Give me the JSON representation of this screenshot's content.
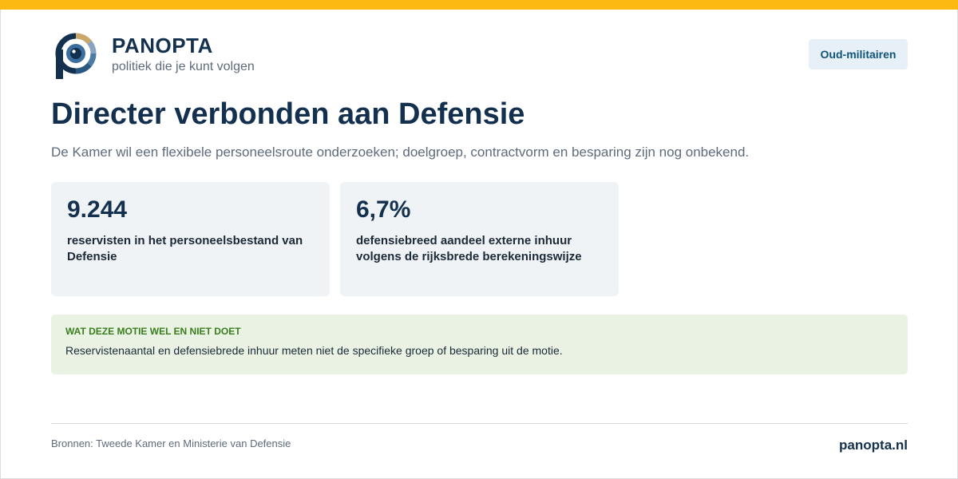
{
  "brand": {
    "name": "PANOPTA",
    "tagline": "politiek die je kunt volgen"
  },
  "topic_tag": "Oud-militairen",
  "headline": "Directer verbonden aan Defensie",
  "summary": "De Kamer wil een flexibele personeelsroute onderzoeken; doelgroep, contractvorm en besparing zijn nog onbekend.",
  "stats": [
    {
      "value": "9.244",
      "label": "reservisten in het personeelsbestand van Defensie"
    },
    {
      "value": "6,7%",
      "label": "defensiebreed aandeel externe inhuur volgens de rijksbrede berekeningswijze"
    }
  ],
  "note": {
    "title": "WAT DEZE MOTIE WEL EN NIET DOET",
    "body": "Reservistenaantal en defensiebrede inhuur meten niet de specifieke groep of besparing uit de motie."
  },
  "footer": {
    "sources": "Bronnen: Tweede Kamer en Ministerie van Defensie",
    "site": "panopta.nl"
  },
  "colors": {
    "accent_bar": "#fdb913",
    "navy": "#14304f",
    "note_bg": "#e9f2e3",
    "note_title": "#3a7d1e",
    "stat_bg": "#f0f3f6"
  },
  "icons": {
    "logo": "panopta-eye-logo-icon"
  }
}
